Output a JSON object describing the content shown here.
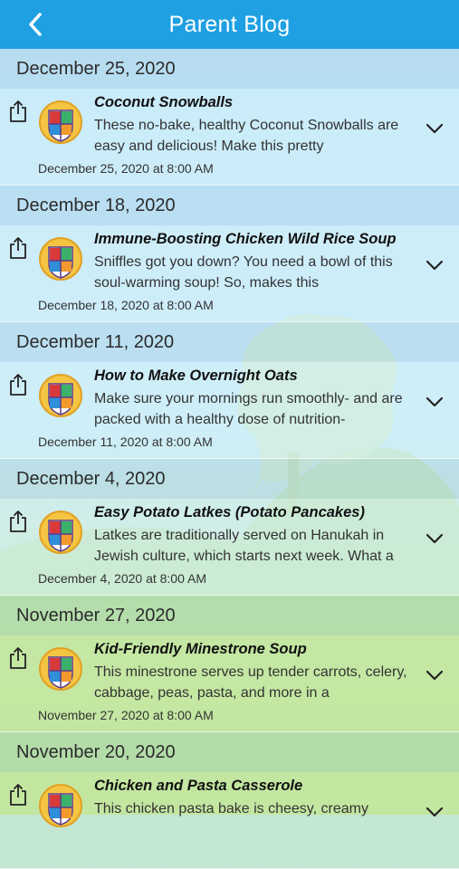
{
  "header": {
    "title": "Parent Blog",
    "back_icon": "chevron-left-icon"
  },
  "colors": {
    "nav_bar": "#1fa0e3",
    "text": "#111111"
  },
  "sections": [
    {
      "date": "December 25, 2020",
      "post": {
        "title": "Coconut Snowballs",
        "excerpt": "These no-bake, healthy Coconut Snowballs are easy and delicious! Make this pretty",
        "published": "December 25, 2020 at 8:00 AM"
      }
    },
    {
      "date": "December 18, 2020",
      "post": {
        "title": "Immune-Boosting Chicken Wild Rice Soup",
        "excerpt": "Sniffles got you down? You need a bowl of this soul-warming soup! So, makes this",
        "published": "December 18, 2020 at 8:00 AM"
      }
    },
    {
      "date": "December 11, 2020",
      "post": {
        "title": "How to Make Overnight Oats",
        "excerpt": "Make sure your mornings run smoothly- and are packed with a healthy dose of nutrition-",
        "published": "December 11, 2020 at 8:00 AM"
      }
    },
    {
      "date": "December 4, 2020",
      "post": {
        "title": "Easy Potato Latkes (Potato Pancakes)",
        "excerpt": "Latkes are traditionally served on Hanukah in Jewish culture, which starts next week. What a",
        "published": "December 4, 2020 at 8:00 AM"
      }
    },
    {
      "date": "November 27, 2020",
      "post": {
        "title": "Kid-Friendly Minestrone Soup",
        "excerpt": "This minestrone serves up tender carrots, celery, cabbage, peas, pasta, and more in a",
        "published": "November 27, 2020 at 8:00 AM"
      }
    },
    {
      "date": "November 20, 2020",
      "post": {
        "title": "Chicken and Pasta Casserole",
        "excerpt": "This chicken pasta bake is cheesy, creamy",
        "published": ""
      }
    }
  ]
}
